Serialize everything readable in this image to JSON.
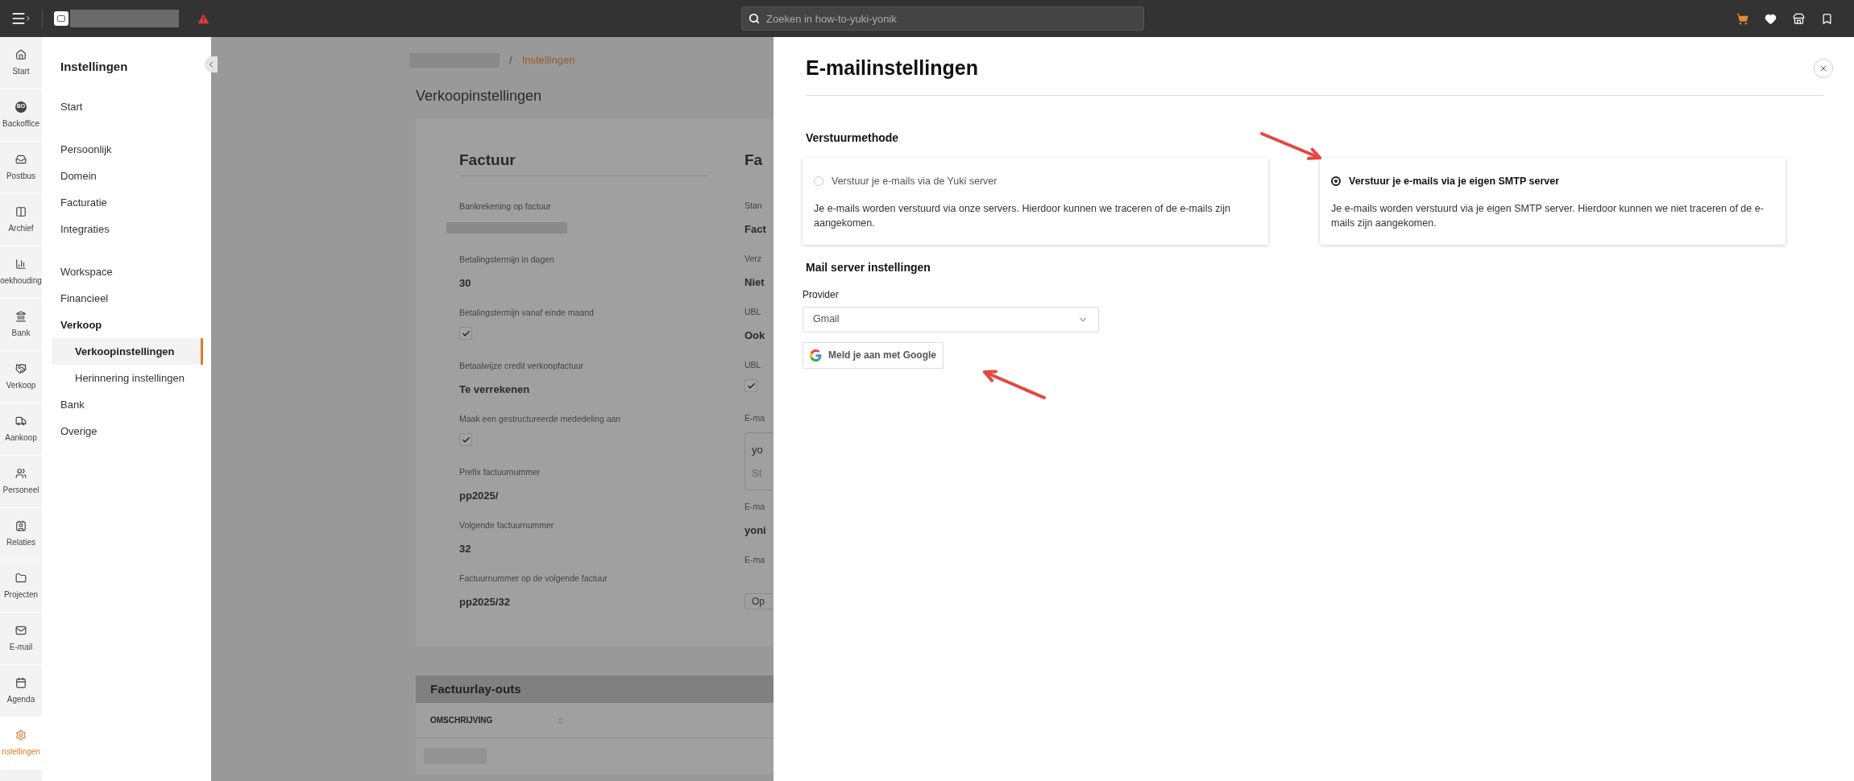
{
  "top_bar": {
    "search": {
      "placeholder": "Zoeken in how-to-yuki-yonik"
    }
  },
  "nav_rail": [
    {
      "label": "Start",
      "selected": false
    },
    {
      "label": "Backoffice",
      "badge": "BO",
      "selected": false
    },
    {
      "label": "Postbus",
      "selected": false
    },
    {
      "label": "Archief",
      "selected": false
    },
    {
      "label": "oekhouding",
      "selected": false
    },
    {
      "label": "Bank",
      "selected": false
    },
    {
      "label": "Verkoop",
      "selected": false
    },
    {
      "label": "Aankoop",
      "selected": false
    },
    {
      "label": "Personeel",
      "selected": false
    },
    {
      "label": "Relaties",
      "selected": false
    },
    {
      "label": "Projecten",
      "selected": false
    },
    {
      "label": "E-mail",
      "selected": false
    },
    {
      "label": "Agenda",
      "selected": false
    },
    {
      "label": "nstellingen",
      "selected": true
    }
  ],
  "settings_sidebar": {
    "title": "Instellingen",
    "groups": [
      [
        {
          "label": "Start",
          "kind": "item",
          "selected": false
        }
      ],
      [
        {
          "label": "Persoonlijk",
          "kind": "item",
          "selected": false
        },
        {
          "label": "Domein",
          "kind": "item",
          "selected": false
        },
        {
          "label": "Facturatie",
          "kind": "item",
          "selected": false
        },
        {
          "label": "Integraties",
          "kind": "item",
          "selected": false
        }
      ],
      [
        {
          "label": "Workspace",
          "kind": "item",
          "selected": false
        },
        {
          "label": "Financieel",
          "kind": "item",
          "selected": false
        },
        {
          "label": "Verkoop",
          "kind": "header",
          "selected": false
        },
        {
          "label": "Verkoopinstellingen",
          "kind": "subitem",
          "selected": true
        },
        {
          "label": "Herinnering instellingen",
          "kind": "subitem",
          "selected": false
        },
        {
          "label": "Bank",
          "kind": "item",
          "selected": false
        },
        {
          "label": "Overige",
          "kind": "item",
          "selected": false
        }
      ]
    ]
  },
  "breadcrumb": {
    "separator": "/",
    "current": "Instellingen"
  },
  "page_title": "Verkoopinstellingen",
  "invoice_card": {
    "heading": "Factuur",
    "fields": [
      {
        "label": "Bankrekening op factuur",
        "kind": "blurred"
      },
      {
        "label": "Betalingstermijn in dagen",
        "kind": "text",
        "value": "30"
      },
      {
        "label": "Betalingstermijn vanaf einde maand",
        "kind": "checkbox",
        "checked": true
      },
      {
        "label": "Betaalwijze credit verkoopfactuur",
        "kind": "text",
        "value": "Te verrekenen"
      },
      {
        "label": "Maak een gestructureerde mededeling aan",
        "kind": "checkbox",
        "checked": true
      },
      {
        "label": "Prefix factuurnummer",
        "kind": "text",
        "value": "pp2025/"
      },
      {
        "label": "Volgende factuurnummer",
        "kind": "text",
        "value": "32"
      },
      {
        "label": "Factuurnummer op de volgende factuur",
        "kind": "text",
        "value": "pp2025/32"
      }
    ]
  },
  "column_2": {
    "heading": "Fa",
    "fields": [
      {
        "label": "Stan",
        "kind": "text",
        "value": "Fact"
      },
      {
        "label": "Verz",
        "kind": "text",
        "value": "Niet"
      },
      {
        "label": "UBL",
        "kind": "text",
        "value": "Ook"
      },
      {
        "label": "UBL",
        "kind": "checkbox",
        "checked": true
      },
      {
        "label": "E-ma",
        "kind": "box",
        "value": "yo",
        "placeholder": "St"
      },
      {
        "label": "E-ma",
        "kind": "text",
        "value": "yoni"
      },
      {
        "label": "E-ma",
        "kind": "button",
        "value": "Op"
      }
    ]
  },
  "layouts_table": {
    "title": "Factuurlay-outs",
    "columns": [
      "OMSCHRIJVING"
    ]
  },
  "panel": {
    "title": "E-mailinstellingen",
    "section_title": "Verstuurmethode",
    "methods": [
      {
        "title": "Verstuur je e-mails via de Yuki server",
        "description": "Je e-mails worden verstuurd via onze servers. Hierdoor kunnen we traceren of de e-mails zijn aangekomen.",
        "selected": false
      },
      {
        "title": "Verstuur je e-mails via je eigen SMTP server",
        "description": "Je e-mails worden verstuurd via je eigen SMTP server. Hierdoor kunnen we niet traceren of de e-mails zijn aangekomen.",
        "selected": true
      }
    ],
    "mail_server_title": "Mail server instellingen",
    "provider_label": "Provider",
    "provider_value": "Gmail",
    "google_button": "Meld je aan met Google"
  }
}
